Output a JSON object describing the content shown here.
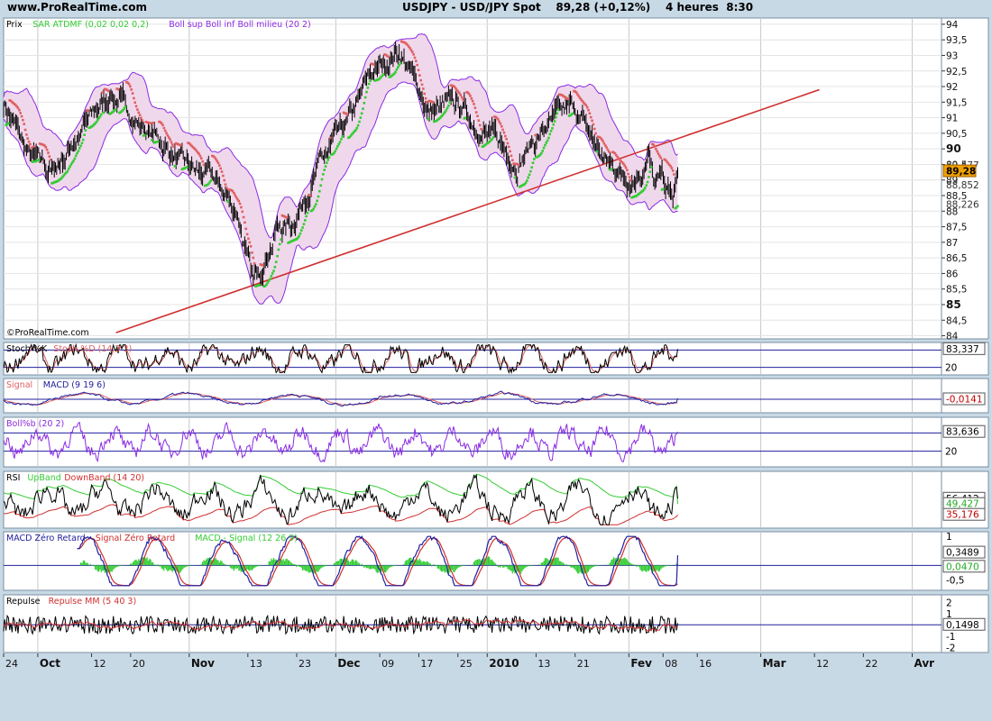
{
  "header": {
    "site": "www.ProRealTime.com",
    "symbol": "USDJPY - USD/JPY Spot",
    "last": "89,28 (+0,12%)",
    "timeframe": "4 heures  8:30"
  },
  "watermark": "©ProRealTime.com",
  "colors": {
    "background": "#c8d9e6",
    "panel": "#ffffff",
    "price": "#000000",
    "sar_up": "#33cc33",
    "sar_down": "#e06060",
    "boll": "#8a2be2",
    "boll_fill": "#f0d8ec",
    "trendline": "#d03030",
    "guide": "#2020a0",
    "price_badge": "#f0a000"
  },
  "chart_data": [
    {
      "type": "line",
      "name": "price",
      "legend": [
        {
          "text": "Prix",
          "color": "#000000"
        },
        {
          "text": "SAR ATDMF (0,02 0,02 0,2)",
          "color": "#33cc33"
        },
        {
          "text": "Boll sup Boll inf Boll milieu (20 2)",
          "color": "#8a2be2"
        }
      ],
      "ylim": [
        83.9,
        94.2
      ],
      "yticks": [
        "84",
        "84,5",
        "85",
        "85,5",
        "86",
        "86,5",
        "87",
        "87,5",
        "88",
        "88,5",
        "89",
        "89,5",
        "90",
        "90,5",
        "91",
        "91,5",
        "92",
        "92,5",
        "93",
        "93,5",
        "94"
      ],
      "ytick_values": [
        84,
        84.5,
        85,
        85.5,
        86,
        86.5,
        87,
        87.5,
        88,
        88.5,
        89,
        89.5,
        90,
        90.5,
        91,
        91.5,
        92,
        92.5,
        93,
        93.5,
        94
      ],
      "bold_ticks": [
        "85",
        "90"
      ],
      "value_labels": [
        {
          "text": "89,477",
          "value": 89.477,
          "style": "plain"
        },
        {
          "text": "89,28",
          "value": 89.28,
          "style": "badge"
        },
        {
          "text": "88,852",
          "value": 88.852,
          "style": "plain"
        },
        {
          "text": "88,226",
          "value": 88.226,
          "style": "plain"
        }
      ],
      "x_days": [
        0,
        6,
        13,
        20,
        27,
        34,
        41,
        48,
        55,
        62,
        69,
        76,
        83,
        90,
        97,
        104,
        111,
        118,
        125,
        132,
        139,
        146,
        153,
        160,
        167
      ],
      "close": [
        91.5,
        89.8,
        89.2,
        90.4,
        91.8,
        90.8,
        90.1,
        89.3,
        89.0,
        87.9,
        85.6,
        87.5,
        87.6,
        89.3,
        90.6,
        92.3,
        93.2,
        91.2,
        91.4,
        90.5,
        89.6,
        90.7,
        91.3,
        89.6,
        89.1,
        89.2,
        89.3,
        89.5,
        90.0,
        88.9,
        88.9,
        89.0,
        88.6,
        88.3,
        89.28
      ],
      "close_days": [
        0,
        5,
        10,
        15,
        22,
        28,
        33,
        38,
        43,
        48,
        51,
        56,
        59,
        64,
        70,
        75,
        81,
        87,
        93,
        99,
        105,
        111,
        117,
        123,
        128,
        129,
        130,
        131,
        132,
        133,
        134,
        135,
        136,
        137,
        138
      ],
      "trendline": [
        {
          "day": 23,
          "value": 84.1
        },
        {
          "day": 167,
          "value": 91.9
        }
      ]
    },
    {
      "type": "line",
      "name": "stoch",
      "legend": [
        {
          "text": "Stoch %K",
          "color": "#000000"
        },
        {
          "text": "Stoch %D (14 3 3)",
          "color": "#e06060"
        }
      ],
      "ylim": [
        0,
        100
      ],
      "guides": [
        80,
        20
      ],
      "ytick_labels": [
        "20"
      ],
      "last_value": "83,337",
      "last_value_num": 83.337
    },
    {
      "type": "line",
      "name": "macd",
      "legend": [
        {
          "text": "Signal",
          "color": "#e06060"
        },
        {
          "text": "MACD (9 19 6)",
          "color": "#2020a0"
        }
      ],
      "last_value": "-0,0141",
      "last_value_num": -0.0141
    },
    {
      "type": "line",
      "name": "bollb",
      "legend": [
        {
          "text": "Boll%b (20 2)",
          "color": "#8a2be2"
        }
      ],
      "ylim": [
        -0.2,
        1.2
      ],
      "ytick_labels": [
        "20"
      ],
      "last_value": "83,636",
      "last_value_num": 0.83636
    },
    {
      "type": "line",
      "name": "rsi",
      "legend": [
        {
          "text": "RSI",
          "color": "#000000"
        },
        {
          "text": "UpBand",
          "color": "#33cc33"
        },
        {
          "text": "DownBand (14 20)",
          "color": "#d03030"
        }
      ],
      "ylim": [
        20,
        90
      ],
      "last_values": [
        {
          "text": "56,412",
          "value": 56.412
        },
        {
          "text": "49,427",
          "value": 49.427
        },
        {
          "text": "35,176",
          "value": 35.176
        }
      ]
    },
    {
      "type": "line",
      "name": "macd-zero-lag",
      "legend": [
        {
          "text": "MACD Zéro Retard",
          "color": "#2020a0"
        },
        {
          "text": "Signal Zéro Retard",
          "color": "#d03030"
        },
        {
          "text": "MACD - Signal (12 26 9)",
          "color": "#33cc33"
        }
      ],
      "ylim": [
        -0.8,
        1.1
      ],
      "yticks": [
        "1",
        "-0,5"
      ],
      "ytick_values": [
        1,
        -0.5
      ],
      "last_values": [
        {
          "text": "0,3489",
          "value": 0.3489
        },
        {
          "text": "0,0470",
          "value": 0.047
        }
      ]
    },
    {
      "type": "line",
      "name": "repulse",
      "legend": [
        {
          "text": "Repulse",
          "color": "#000000"
        },
        {
          "text": "Repulse MM (5 40 3)",
          "color": "#d03030"
        }
      ],
      "ylim": [
        -2.3,
        2.5
      ],
      "yticks": [
        "2",
        "1",
        "-1",
        "-2"
      ],
      "ytick_values": [
        2,
        1,
        -1,
        -2
      ],
      "last_value": "0,1498",
      "last_value_num": 0.1498
    }
  ],
  "x_axis": {
    "labels": [
      {
        "text": "24",
        "day": 0,
        "bold": false
      },
      {
        "text": "Oct",
        "day": 7,
        "bold": true
      },
      {
        "text": "12",
        "day": 18,
        "bold": false
      },
      {
        "text": "20",
        "day": 26,
        "bold": false
      },
      {
        "text": "Nov",
        "day": 38,
        "bold": true
      },
      {
        "text": "13",
        "day": 50,
        "bold": false
      },
      {
        "text": "23",
        "day": 60,
        "bold": false
      },
      {
        "text": "Dec",
        "day": 68,
        "bold": true
      },
      {
        "text": "09",
        "day": 77,
        "bold": false
      },
      {
        "text": "17",
        "day": 85,
        "bold": false
      },
      {
        "text": "25",
        "day": 93,
        "bold": false
      },
      {
        "text": "2010",
        "day": 99,
        "bold": true
      },
      {
        "text": "13",
        "day": 109,
        "bold": false
      },
      {
        "text": "21",
        "day": 117,
        "bold": false
      },
      {
        "text": "Fev",
        "day": 128,
        "bold": true
      },
      {
        "text": "08",
        "day": 135,
        "bold": false
      },
      {
        "text": "16",
        "day": 142,
        "bold": false
      },
      {
        "text": "Mar",
        "day": 155,
        "bold": true
      },
      {
        "text": "12",
        "day": 166,
        "bold": false
      },
      {
        "text": "22",
        "day": 176,
        "bold": false
      },
      {
        "text": "Avr",
        "day": 186,
        "bold": true
      }
    ],
    "day_range": [
      0,
      192
    ],
    "last_data_day": 138
  }
}
